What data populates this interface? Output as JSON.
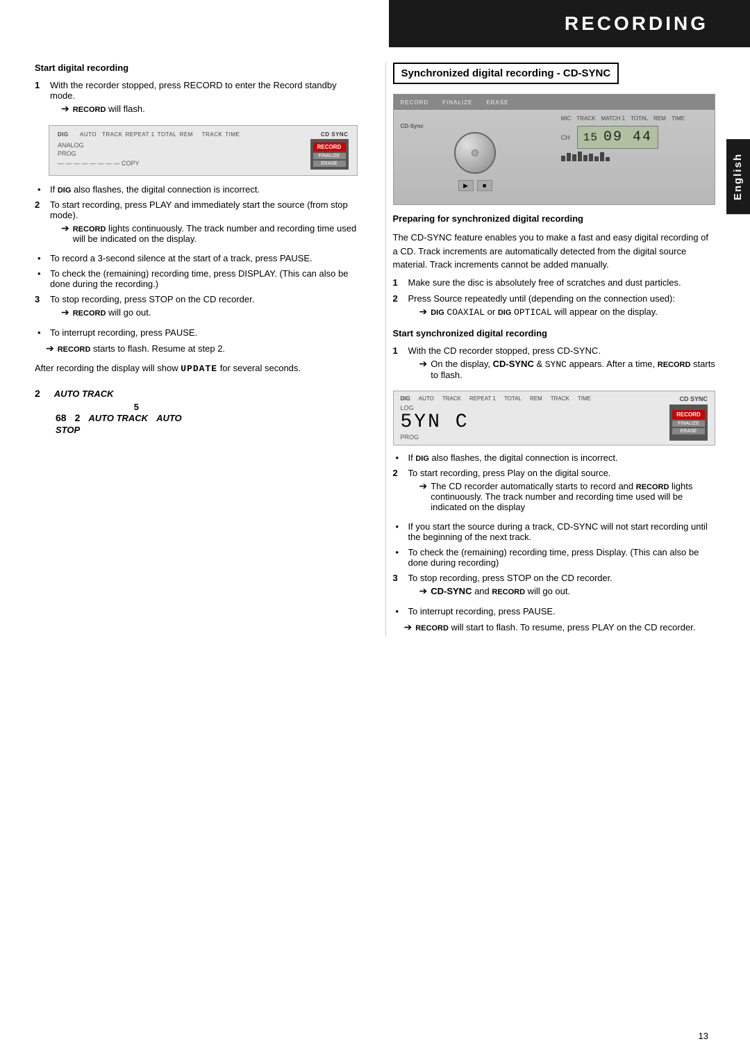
{
  "page": {
    "title": "RECORDING",
    "page_number": "13",
    "side_tab": "English"
  },
  "left_column": {
    "section1": {
      "heading": "Start digital recording",
      "steps": [
        {
          "num": "1",
          "text": "With the recorder stopped, press RECORD to enter the Record standby mode."
        },
        {
          "num": "2",
          "text": "To start recording, press PLAY and immediately start the source (from stop mode)."
        },
        {
          "num": "3",
          "text": "To stop recording, press STOP on the CD recorder."
        }
      ],
      "bullets": [
        "RECORD will flash.",
        "If DIG also flashes, the digital connection is incorrect.",
        "RECORD lights continuously. The track number and recording time used will be indicated on the display.",
        "To record a 3-second silence at the start of a track, press PAUSE.",
        "To check the (remaining) recording time, press DISPLAY. (This can also be done during the recording.)",
        "RECORD will go out.",
        "To interrupt recording, press PAUSE.",
        "RECORD starts to flash. Resume at step 2."
      ],
      "update_text": "After recording the display will show UPDATE for several seconds."
    },
    "display1": {
      "labels": [
        "DIG",
        "AUTO",
        "TRACK",
        "REPEAT 1",
        "TOTAL",
        "REM",
        "TRACK",
        "TIME",
        "CD SYNC"
      ],
      "analog_label": "ANALOG",
      "prog_label": "PROG",
      "record_btn": "RECORD",
      "finalize_btn": "FINALIZE",
      "erase_btn": "ERASE",
      "copy_label": "COPY"
    },
    "auto_track_diagram": {
      "row1_num": "2",
      "row1_label": "AUTO TRACK",
      "row1_num2": "5",
      "row2_num1": "68",
      "row2_num2": "2",
      "row2_label": "AUTO TRACK",
      "row2_label2": "AUTO",
      "stop_label": "STOP"
    }
  },
  "right_column": {
    "section_heading": "Synchronized digital recording - CD-SYNC",
    "cd_player": {
      "top_labels": [
        "RECORD",
        "FINALIZE",
        "ERASE"
      ],
      "cd_sync_label": "CD-Sync",
      "display_labels": [
        "MIC",
        "TRACK",
        "MATCH 1",
        "TOTAL",
        "REM",
        "TIME"
      ],
      "ch_label": "CH",
      "track_num": "15",
      "time_display": "09 44"
    },
    "prep_heading": "Preparing for synchronized digital recording",
    "prep_text": "The CD-SYNC feature enables you to make a fast and easy digital recording of a CD. Track increments are automatically detected from the digital source material. Track increments cannot be added manually.",
    "prep_steps": [
      {
        "num": "1",
        "text": "Make sure the disc is absolutely free of scratches and dust particles."
      },
      {
        "num": "2",
        "text": "Press Source repeatedly until (depending on the connection used):"
      }
    ],
    "dig_text": "DIG COAXIAL or DIG OPTICAL will appear on the display.",
    "start_sync_heading": "Start synchronized digital recording",
    "sync_steps": [
      {
        "num": "1",
        "text": "With the CD recorder stopped, press CD-SYNC."
      },
      {
        "num": "2",
        "text": "To start recording, press Play on the digital source."
      },
      {
        "num": "3",
        "text": "To stop recording, press STOP on the CD recorder."
      }
    ],
    "sync_display": {
      "labels": [
        "DIG",
        "AUTO",
        "TRACK",
        "REPEAT 1",
        "TOTAL",
        "REM",
        "TRACK",
        "TIME",
        "CD SYNC"
      ],
      "log_label": "LOG",
      "prog_label": "PROG",
      "sync_digits": "5YNC",
      "record_btn": "RECORD",
      "finalize_btn": "FINALIZE",
      "erase_btn": "ERASE"
    },
    "sync_bullets": [
      {
        "text": "On the display, CD-SYNC & SYNC appears. After a time, RECORD starts to flash.",
        "is_arrow": true
      },
      {
        "text": "If DIG also flashes, the digital connection is incorrect.",
        "is_bullet": true
      },
      {
        "text": "The CD recorder automatically starts to record and RECORD lights continuously. The track number and recording time used will be indicated on the display",
        "is_arrow": true
      },
      {
        "text": "If you start the source during a track, CD-SYNC will not start recording until the beginning of the next track.",
        "is_bullet": true
      },
      {
        "text": "To check the (remaining) recording time, press Display. (This can also be done during recording)",
        "is_bullet": true
      },
      {
        "text": "CD-SYNC and RECORD will go out.",
        "is_arrow": true
      },
      {
        "text": "To interrupt recording, press PAUSE.",
        "is_bullet": true
      },
      {
        "text": "RECORD will start to flash. To resume, press PLAY on the CD recorder.",
        "is_arrow": true
      }
    ]
  }
}
